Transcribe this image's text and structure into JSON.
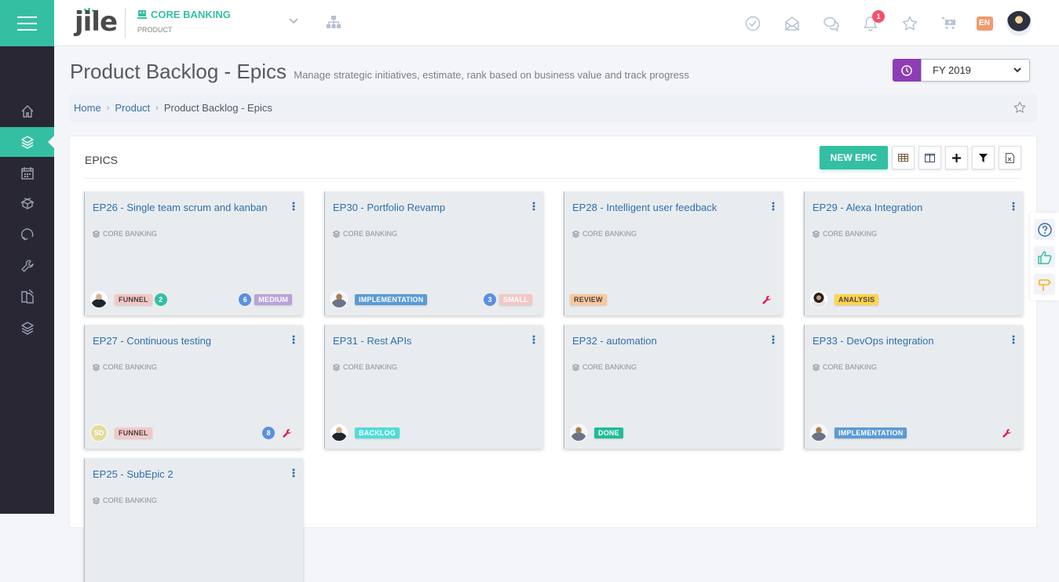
{
  "header": {
    "logo": "jile",
    "product_name": "CORE BANKING",
    "product_type": "PRODUCT",
    "notification_count": "1",
    "language": "EN",
    "icons": [
      "check-circle-icon",
      "mail-open-icon",
      "chat-icon",
      "bell-icon",
      "star-icon",
      "cart-plus-icon"
    ]
  },
  "sidebar": {
    "items": [
      {
        "name": "home",
        "icon": "home-icon",
        "active": false
      },
      {
        "name": "product",
        "icon": "layers-icon",
        "active": true
      },
      {
        "name": "calendar",
        "icon": "calendar-icon",
        "active": false
      },
      {
        "name": "release",
        "icon": "box-icon",
        "active": false
      },
      {
        "name": "sprint",
        "icon": "refresh-icon",
        "active": false
      },
      {
        "name": "tools",
        "icon": "wrench-icon",
        "active": false
      },
      {
        "name": "documents",
        "icon": "copy-icon",
        "active": false
      },
      {
        "name": "portfolio",
        "icon": "layers-icon",
        "active": false
      }
    ]
  },
  "page": {
    "title": "Product Backlog - Epics",
    "subtitle": "Manage strategic initiatives, estimate, rank based on business value and track progress",
    "fiscal_year": "FY 2019"
  },
  "breadcrumb": {
    "items": [
      "Home",
      "Product"
    ],
    "current": "Product Backlog - Epics"
  },
  "panel": {
    "title": "EPICS",
    "new_button": "NEW EPIC",
    "tools": [
      "table-view-icon",
      "column-view-icon",
      "add-icon",
      "filter-icon",
      "excel-export-icon"
    ]
  },
  "colors": {
    "accent": "#34bfa3",
    "sidebar": "#282733",
    "fy_icon": "#8f3db6",
    "link": "#2f6fad",
    "danger": "#f4516c"
  },
  "cards": [
    {
      "title": "EP26 - Single team scrum and kanban",
      "product": "CORE BANKING",
      "avatar": "man",
      "status": "FUNNEL",
      "status_bg": "#f4c7c7",
      "status_fg": "#444",
      "child_count": "2",
      "points": "6",
      "size": "MEDIUM",
      "size_bg": "#b9a3d8",
      "size_fg": "#fff",
      "wrench": false
    },
    {
      "title": "EP30 - Portfolio Revamp",
      "product": "CORE BANKING",
      "avatar": "man2",
      "status": "IMPLEMENTATION",
      "status_bg": "#5b9bd5",
      "status_fg": "#fff",
      "child_count": null,
      "points": "3",
      "size": "SMALL",
      "size_bg": "#f4c7c7",
      "size_fg": "#fff",
      "wrench": false
    },
    {
      "title": "EP28 - Intelligent user feedback",
      "product": "CORE BANKING",
      "avatar": null,
      "status": "REVIEW",
      "status_bg": "#f9c89b",
      "status_fg": "#444",
      "child_count": null,
      "points": null,
      "size": null,
      "wrench": true
    },
    {
      "title": "EP29 - Alexa Integration",
      "product": "CORE BANKING",
      "avatar": "woman",
      "status": "ANALYSIS",
      "status_bg": "#ffd54f",
      "status_fg": "#444",
      "child_count": null,
      "points": null,
      "size": null,
      "wrench": false
    },
    {
      "title": "EP27 - Continuous testing",
      "product": "CORE BANKING",
      "avatar": "initials",
      "initials": "SD",
      "status": "FUNNEL",
      "status_bg": "#f4c7c7",
      "status_fg": "#444",
      "child_count": null,
      "points": "8",
      "size": null,
      "wrench": true
    },
    {
      "title": "EP31 - Rest APIs",
      "product": "CORE BANKING",
      "avatar": "man",
      "status": "BACKLOG",
      "status_bg": "#4fdcd8",
      "status_fg": "#fff",
      "child_count": null,
      "points": null,
      "size": null,
      "wrench": false
    },
    {
      "title": "EP32 - automation",
      "product": "CORE BANKING",
      "avatar": "man2",
      "status": "DONE",
      "status_bg": "#1fbc98",
      "status_fg": "#fff",
      "child_count": null,
      "points": null,
      "size": null,
      "wrench": false
    },
    {
      "title": "EP33 - DevOps integration",
      "product": "CORE BANKING",
      "avatar": "man2",
      "status": "IMPLEMENTATION",
      "status_bg": "#5b9bd5",
      "status_fg": "#fff",
      "child_count": null,
      "points": null,
      "size": null,
      "wrench": true
    },
    {
      "title": "EP25 - SubEpic 2",
      "product": "CORE BANKING",
      "avatar": null,
      "status": null,
      "child_count": null,
      "points": null,
      "size": null,
      "wrench": false
    }
  ],
  "help": {
    "icons": [
      "help-icon",
      "thumbs-up-icon",
      "signpost-icon"
    ]
  }
}
